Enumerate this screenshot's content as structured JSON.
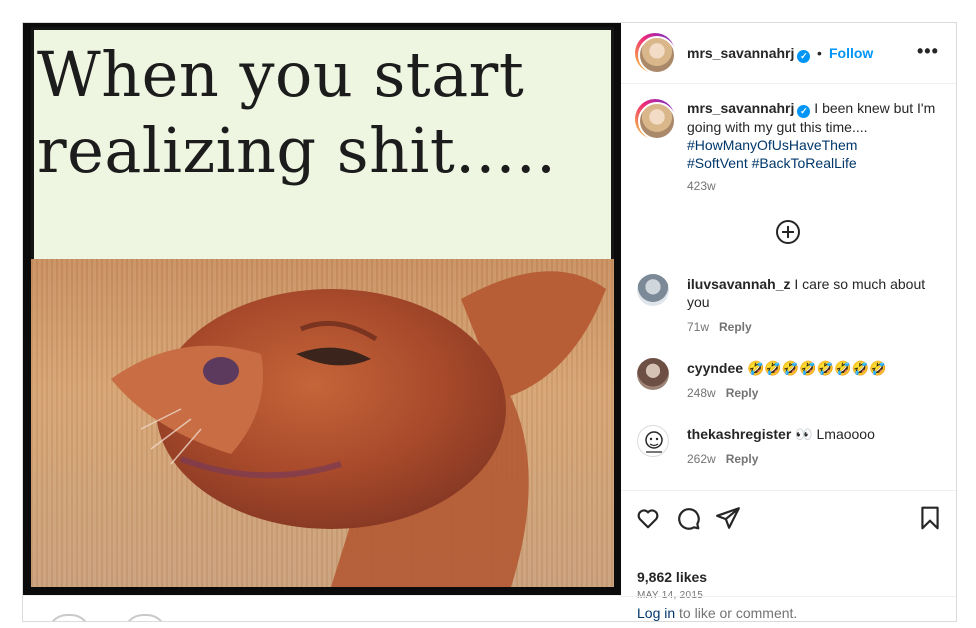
{
  "post": {
    "image": {
      "meme_text": "When you start\nrealizing shit....."
    },
    "header": {
      "username": "mrs_savannahrj",
      "separator": "•",
      "follow_label": "Follow",
      "more_label": "•••"
    },
    "caption": {
      "username": "mrs_savannahrj",
      "text": "I been knew but I'm going with my gut this time....",
      "hashtags": [
        "#HowManyOfUsHaveThem",
        "#SoftVent",
        "#BackToRealLife"
      ],
      "age": "423w"
    },
    "comments": [
      {
        "username": "iluvsavannah_z",
        "text": "I care so much about you",
        "age": "71w",
        "reply_label": "Reply"
      },
      {
        "username": "cyyndee",
        "text": "🤣🤣🤣🤣🤣🤣🤣🤣",
        "age": "248w",
        "reply_label": "Reply"
      },
      {
        "username": "thekashregister",
        "text": "👀 Lmaoooo",
        "age": "262w",
        "reply_label": "Reply"
      }
    ],
    "likes": "9,862 likes",
    "date": "MAY 14, 2015",
    "login_prompt": {
      "link": "Log in",
      "text": "to like or comment."
    }
  },
  "colors": {
    "accent": "#0095f6",
    "hashtag": "#00376b",
    "muted": "#737373",
    "text": "#262626"
  },
  "icons": [
    "heart-icon",
    "comment-icon",
    "share-icon",
    "bookmark-icon",
    "plus-circle-icon",
    "verified-badge-icon",
    "more-options-icon"
  ]
}
